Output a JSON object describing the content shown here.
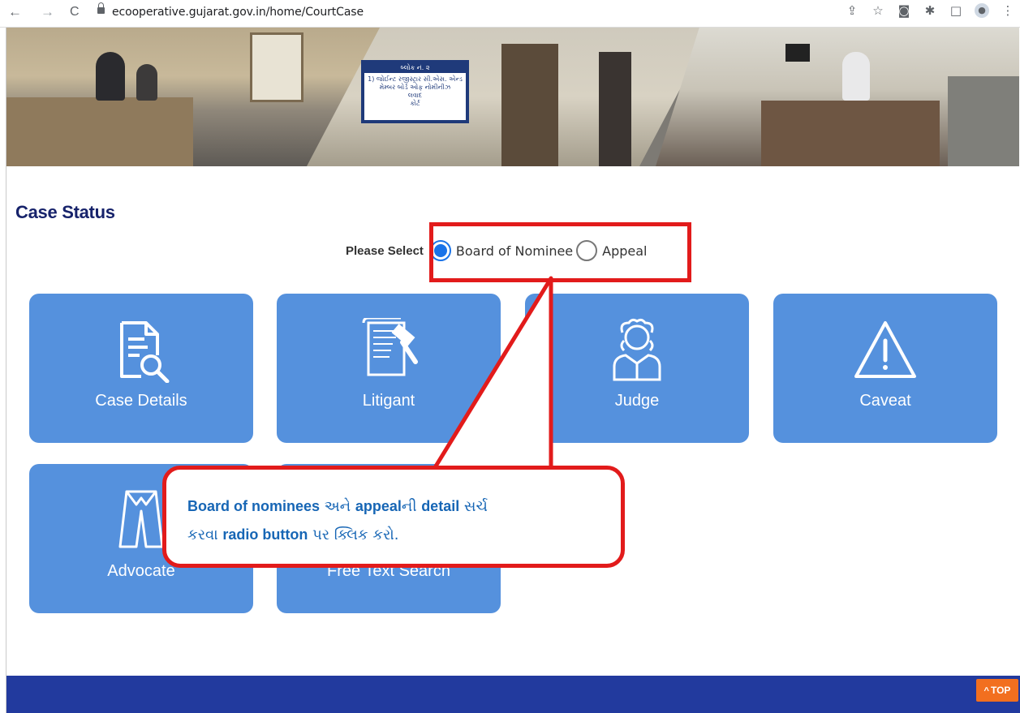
{
  "browser": {
    "url": "ecooperative.gujarat.gov.in/home/CourtCase",
    "back_icon": "←",
    "forward_icon": "→",
    "reload_icon": "C",
    "icons": [
      "share-icon",
      "star-icon",
      "camera-icon",
      "extensions-icon",
      "sidepanel-icon",
      "profile-icon",
      "menu-icon"
    ]
  },
  "hero": {
    "sign_lines": [
      "બ્લોક નં. ૨",
      "1) જોઈન્ટ રજીસ્ટ્રાર સી.એસ. એન્ડ",
      "મેમ્બર બોર્ડ ઓફ નોમીનીઝ",
      "લવાદ",
      "કોર્ટ"
    ]
  },
  "page": {
    "title": "Case Status",
    "selector_label": "Please Select",
    "options": [
      {
        "label": "Board of Nominee",
        "checked": true
      },
      {
        "label": "Appeal",
        "checked": false
      }
    ]
  },
  "cards": [
    {
      "label": "Case Details",
      "icon": "document-search-icon"
    },
    {
      "label": "Litigant",
      "icon": "scroll-gavel-icon"
    },
    {
      "label": "Judge",
      "icon": "judge-icon"
    },
    {
      "label": "Caveat",
      "icon": "warning-triangle-icon"
    },
    {
      "label": "Advocate",
      "icon": "advocate-gown-icon"
    },
    {
      "label": "Free Text Search",
      "icon": "text-search-icon"
    }
  ],
  "callout": {
    "part1": "Board of nominees",
    "part2": " અને ",
    "part3": "appeal",
    "part4": "ની ",
    "part5": "detail",
    "part6": " સર્ચ",
    "part7": "કરવા ",
    "part8": "radio button",
    "part9": " પર ક્લિક કરો."
  },
  "footer": {
    "top_label": "TOP",
    "top_icon": "^"
  },
  "colors": {
    "card": "#5591dd",
    "title": "#17236b",
    "highlight": "#e21b1b",
    "footer": "#223a9e",
    "top_button": "#f26f1f",
    "callout_text": "#1766b5"
  }
}
